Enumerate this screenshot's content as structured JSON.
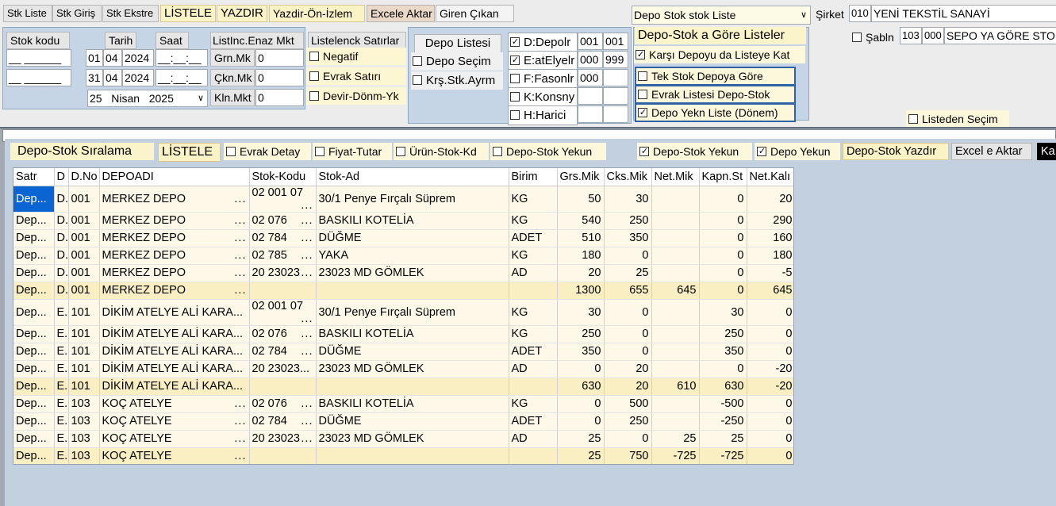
{
  "toolbar": {
    "items": [
      "Stk Liste",
      "Stk Giriş",
      "Stk Ekstre",
      "LİSTELE",
      "YAZDIR",
      "Yazdir-Ön-İzlem",
      "Excele Aktar",
      "Giren Çıkan"
    ]
  },
  "report_select": {
    "value": "Depo Stok stok Liste"
  },
  "company": {
    "label": "Şirket",
    "code": "010",
    "name": "YENİ TEKSTİL SANAYİ"
  },
  "template": {
    "label": "Şabln",
    "code1": "103",
    "code2": "000",
    "name": "SEPO YA GÖRE STOK"
  },
  "filters": {
    "stock_code_label": "Stok kodu",
    "stock_code_from": "__ ______",
    "stock_code_to": "__ ______",
    "date_label": "Tarih",
    "time_label": "Saat",
    "date_from": {
      "d": "01",
      "m": "04",
      "y": "2024"
    },
    "date_to": {
      "d": "31",
      "m": "04",
      "y": "2024"
    },
    "time_from": "__:__:__",
    "time_to": "__:__:__",
    "date_picker": {
      "d": "25",
      "m": "Nisan",
      "y": "2025"
    },
    "min_label": "ListInc.Enaz Mkt",
    "min_rows": [
      {
        "label": "Grn.Mk",
        "value": "0"
      },
      {
        "label": "Çkn.Mk",
        "value": "0"
      },
      {
        "label": "Kln.Mkt",
        "value": "0"
      }
    ]
  },
  "list_rows": {
    "title": "Listelenck Satırlar",
    "items": [
      {
        "label": "Negatif",
        "checked": false
      },
      {
        "label": "Evrak Satırı",
        "checked": false
      },
      {
        "label": "Devir-Dönm-Yk",
        "checked": false
      }
    ]
  },
  "depo": {
    "list_button": "Depo Listesi",
    "options": [
      {
        "label": "Depo Seçim",
        "checked": false
      },
      {
        "label": "Krş.Stk.Ayrm",
        "checked": false
      }
    ],
    "types": [
      {
        "label": "D:Depolr",
        "checked": true,
        "from": "001",
        "to": "001"
      },
      {
        "label": "E:atElyelr",
        "checked": true,
        "from": "000",
        "to": "999"
      },
      {
        "label": "F:Fasonlr",
        "checked": false,
        "from": "000",
        "to": ""
      },
      {
        "label": "K:Konsny",
        "checked": false,
        "from": "",
        "to": ""
      },
      {
        "label": "H:Harici",
        "checked": false,
        "from": "",
        "to": ""
      }
    ]
  },
  "depo_stock": {
    "title": "Depo-Stok a Göre Listeler",
    "karsi": {
      "label": "Karşı Depoyu da Listeye Kat",
      "checked": true
    },
    "options": [
      {
        "label": "Tek Stok Depoya Göre",
        "checked": false
      },
      {
        "label": "Evrak Listesi Depo-Stok",
        "checked": false
      },
      {
        "label": "Depo Yekn Liste (Dönem)",
        "checked": true
      }
    ]
  },
  "list_select": {
    "label": "Listeden Seçim",
    "checked": false
  },
  "grid_toolbar": {
    "sort_label": "Depo-Stok Sıralama",
    "list_button": "LİSTELE",
    "checks": [
      {
        "label": "Evrak Detay",
        "checked": false
      },
      {
        "label": "Fiyat-Tutar",
        "checked": false
      },
      {
        "label": "Ürün-Stok-Kd",
        "checked": false
      },
      {
        "label": "Depo-Stok Yekun",
        "checked": false
      }
    ],
    "right_checks": [
      {
        "label": "Depo-Stok Yekun",
        "checked": true
      },
      {
        "label": "Depo Yekun",
        "checked": true
      }
    ],
    "print_button": "Depo-Stok Yazdır",
    "excel_button": "Excel e Aktar",
    "last_button": "Ka"
  },
  "grid": {
    "columns": [
      "Satr",
      "D",
      "D.No",
      "DEPOADI",
      "Stok-Kodu",
      "Stok-Ad",
      "Birim",
      "Grs.Mik",
      "Cks.Mik",
      "Net.Mik",
      "Kapn.St",
      "Net.Kalı"
    ],
    "rows": [
      {
        "type": "r",
        "c": [
          "Dep...",
          "D.",
          "001",
          "MERKEZ DEPO",
          "02 001 07",
          "30/1 Penye Fırçalı Süprem",
          "KG",
          "50",
          "30",
          "",
          "0",
          "20"
        ]
      },
      {
        "type": "r",
        "c": [
          "Dep...",
          "D.",
          "001",
          "MERKEZ DEPO",
          "02 076",
          "BASKILI KOTELİA",
          "KG",
          "540",
          "250",
          "",
          "0",
          "290"
        ]
      },
      {
        "type": "r",
        "c": [
          "Dep...",
          "D.",
          "001",
          "MERKEZ DEPO",
          "02 784",
          "DÜĞME",
          "ADET",
          "510",
          "350",
          "",
          "0",
          "160"
        ]
      },
      {
        "type": "r",
        "c": [
          "Dep...",
          "D.",
          "001",
          "MERKEZ DEPO",
          "02 785",
          "YAKA",
          "KG",
          "180",
          "0",
          "",
          "0",
          "180"
        ]
      },
      {
        "type": "r",
        "c": [
          "Dep...",
          "D.",
          "001",
          "MERKEZ DEPO",
          "20 23023",
          "23023 MD GÖMLEK",
          "AD",
          "20",
          "25",
          "",
          "0",
          "-5"
        ]
      },
      {
        "type": "t",
        "c": [
          "Dep...",
          "D.",
          "001",
          "MERKEZ DEPO",
          "",
          "",
          "",
          "1300",
          "655",
          "645",
          "0",
          "645"
        ]
      },
      {
        "type": "r",
        "c": [
          "Dep...",
          "E.",
          "101",
          "DİKİM ATELYE ALİ KARA...",
          "02 001 07",
          "30/1 Penye Fırçalı Süprem",
          "KG",
          "30",
          "0",
          "",
          "30",
          "0"
        ]
      },
      {
        "type": "r",
        "c": [
          "Dep...",
          "E.",
          "101",
          "DİKİM ATELYE ALİ KARA...",
          "02 076",
          "BASKILI KOTELİA",
          "KG",
          "250",
          "0",
          "",
          "250",
          "0"
        ]
      },
      {
        "type": "r",
        "c": [
          "Dep...",
          "E.",
          "101",
          "DİKİM ATELYE ALİ KARA...",
          "02 784",
          "DÜĞME",
          "ADET",
          "350",
          "0",
          "",
          "350",
          "0"
        ]
      },
      {
        "type": "r",
        "c": [
          "Dep...",
          "E.",
          "101",
          "DİKİM ATELYE ALİ KARA...",
          "20 23023...",
          "23023 MD GÖMLEK",
          "AD",
          "0",
          "20",
          "",
          "0",
          "-20"
        ]
      },
      {
        "type": "t",
        "c": [
          "Dep...",
          "E.",
          "101",
          "DİKİM ATELYE ALİ KARA...",
          "",
          "",
          "",
          "630",
          "20",
          "610",
          "630",
          "-20"
        ]
      },
      {
        "type": "r",
        "c": [
          "Dep...",
          "E.",
          "103",
          "KOÇ ATELYE",
          "02 076",
          "BASKILI KOTELİA",
          "KG",
          "0",
          "500",
          "",
          "-500",
          "0"
        ]
      },
      {
        "type": "r",
        "c": [
          "Dep...",
          "E.",
          "103",
          "KOÇ ATELYE",
          "02 784",
          "DÜĞME",
          "ADET",
          "0",
          "250",
          "",
          "-250",
          "0"
        ]
      },
      {
        "type": "r",
        "c": [
          "Dep...",
          "E.",
          "103",
          "KOÇ ATELYE",
          "20 23023",
          "23023 MD GÖMLEK",
          "AD",
          "25",
          "0",
          "25",
          "25",
          "0"
        ]
      },
      {
        "type": "t",
        "c": [
          "Dep...",
          "E.",
          "103",
          "KOÇ ATELYE",
          "",
          "",
          "",
          "25",
          "750",
          "-725",
          "-725",
          "0"
        ]
      }
    ]
  }
}
